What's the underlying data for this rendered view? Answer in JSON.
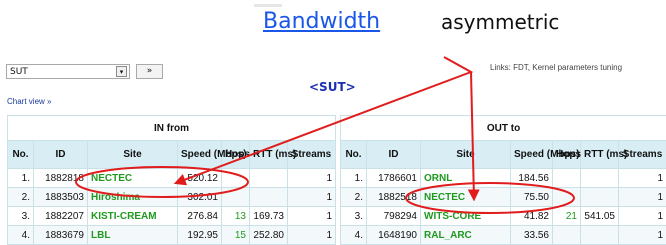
{
  "headline": {
    "link": "Bandwidth",
    "word": "asymmetric"
  },
  "toolbar": {
    "sut_value": "SUT",
    "caret": "▾",
    "go_label": "»"
  },
  "links_tuning": "Links: FDT, Kernel parameters tuning",
  "chart_view": "Chart view »",
  "sut_tag": "<SUT>",
  "columns": [
    "No.",
    "ID",
    "Site",
    "Speed (Mbps)",
    "Hops",
    "RTT (ms)",
    "Streams"
  ],
  "in_table": {
    "title": "IN from",
    "rows": [
      {
        "no": "1.",
        "id": "1882818",
        "site": "NECTEC",
        "speed": "520.12",
        "hops": "",
        "rtt": "",
        "streams": "1"
      },
      {
        "no": "2.",
        "id": "1883503",
        "site": "Hiroshima",
        "speed": "302.01",
        "hops": "",
        "rtt": "",
        "streams": "1"
      },
      {
        "no": "3.",
        "id": "1882207",
        "site": "KISTI-CREAM",
        "speed": "276.84",
        "hops": "13",
        "rtt": "169.73",
        "streams": "1"
      },
      {
        "no": "4.",
        "id": "1883679",
        "site": "LBL",
        "speed": "192.95",
        "hops": "15",
        "rtt": "252.80",
        "streams": "1"
      }
    ]
  },
  "out_table": {
    "title": "OUT to",
    "rows": [
      {
        "no": "1.",
        "id": "1786601",
        "site": "ORNL",
        "speed": "184.56",
        "hops": "",
        "rtt": "",
        "streams": "1"
      },
      {
        "no": "2.",
        "id": "1882518",
        "site": "NECTEC",
        "speed": "75.50",
        "hops": "",
        "rtt": "",
        "streams": "1"
      },
      {
        "no": "3.",
        "id": "798294",
        "site": "WITS-CORE",
        "speed": "41.82",
        "hops": "21",
        "rtt": "541.05",
        "streams": "1"
      },
      {
        "no": "4.",
        "id": "1648190",
        "site": "RAL_ARC",
        "speed": "33.56",
        "hops": "",
        "rtt": "",
        "streams": "1"
      }
    ]
  },
  "colors": {
    "link": "#1a56e8",
    "site": "#1f9a1f",
    "header_bg": "#d8eef4",
    "annotation": "#e01c1c",
    "sut_tag": "#1b2fb0"
  }
}
